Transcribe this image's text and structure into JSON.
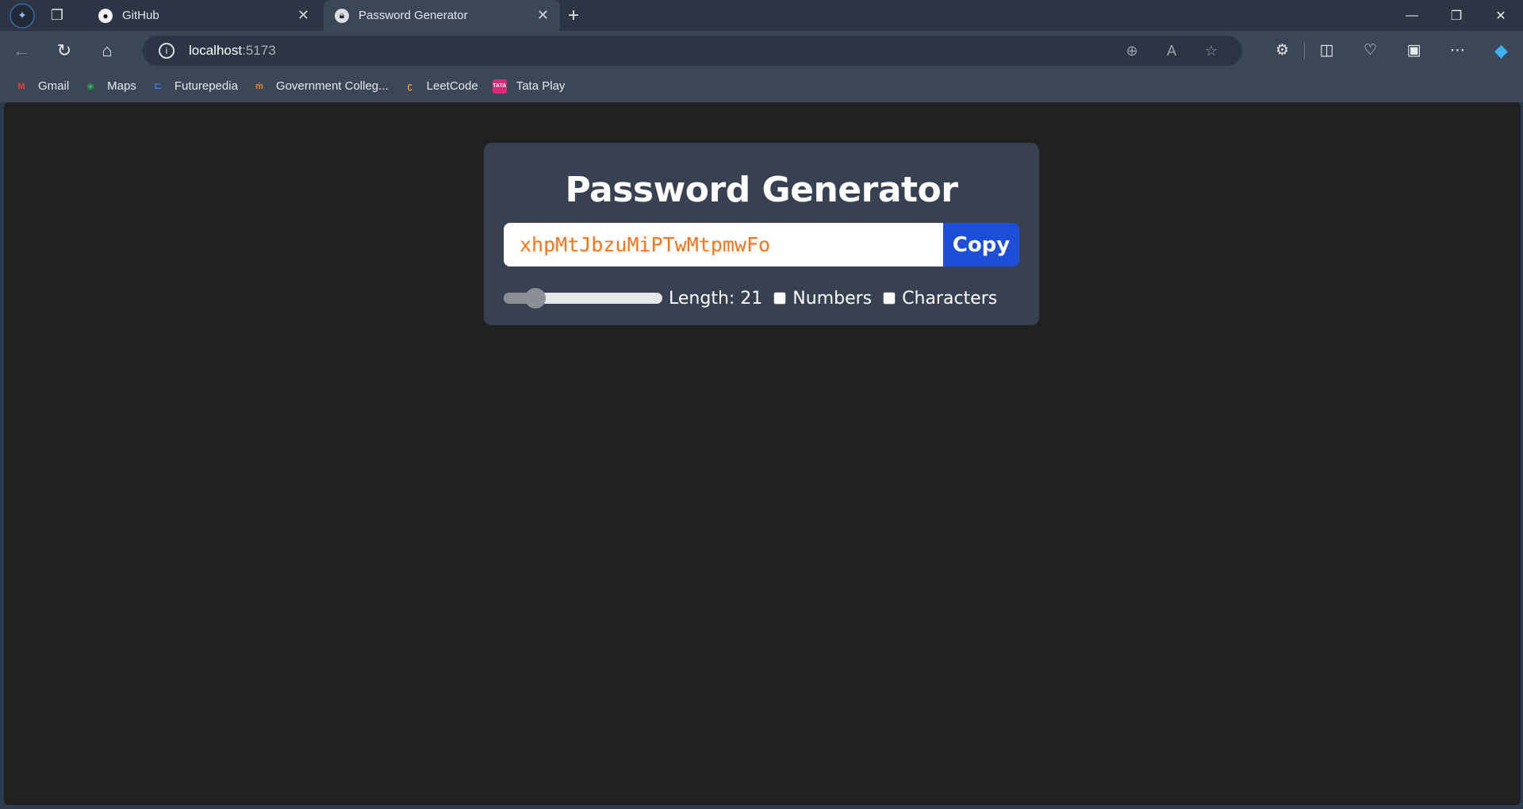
{
  "browser": {
    "tabs": [
      {
        "title": "GitHub",
        "icon": "github-icon"
      },
      {
        "title": "Password Generator",
        "icon": "lock-icon",
        "active": true
      }
    ],
    "address": {
      "host": "localhost",
      "port": ":5173"
    },
    "bookmarks": [
      {
        "label": "Gmail",
        "icon": "gmail-icon"
      },
      {
        "label": "Maps",
        "icon": "maps-icon"
      },
      {
        "label": "Futurepedia",
        "icon": "futurepedia-icon"
      },
      {
        "label": "Government Colleg...",
        "icon": "college-icon"
      },
      {
        "label": "LeetCode",
        "icon": "leetcode-icon"
      },
      {
        "label": "Tata Play",
        "icon": "tataplay-icon"
      }
    ]
  },
  "app": {
    "title": "Password Generator",
    "password": "xhpMtJbzuMiPTwMtpmwFo",
    "copy_label": "Copy",
    "length_label": "Length: 21",
    "length": 21,
    "length_fraction": 0.2,
    "numbers_label": "Numbers",
    "numbers_checked": false,
    "characters_label": "Characters",
    "characters_checked": false,
    "colors": {
      "password_text": "#f97316",
      "copy_button": "#1d4ed8",
      "card_bg": "#374151",
      "page_bg": "#212121"
    }
  }
}
